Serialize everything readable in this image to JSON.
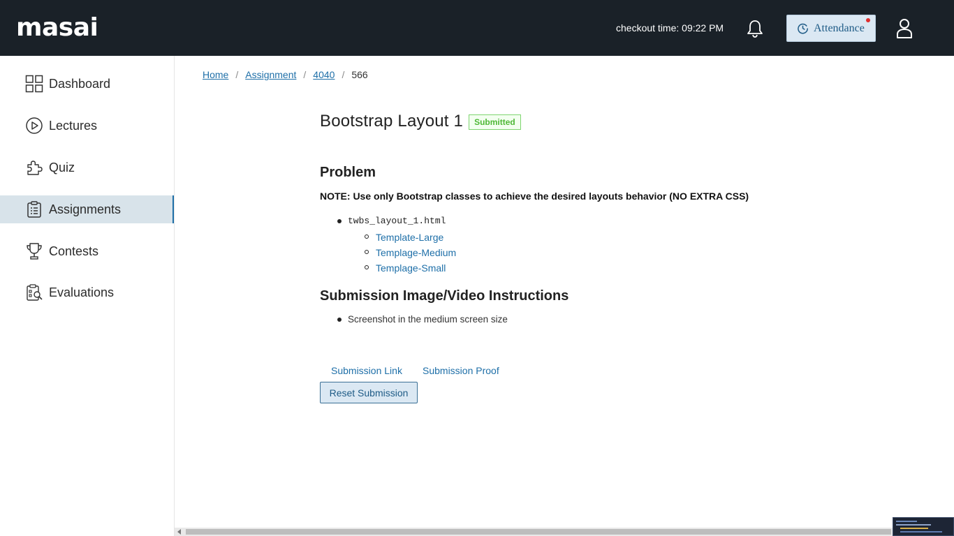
{
  "header": {
    "logo_text": "masai",
    "checkout_time": "checkout time: 09:22 PM",
    "attendance_label": "Attendance"
  },
  "sidebar": {
    "items": [
      {
        "label": "Dashboard",
        "icon": "grid-icon"
      },
      {
        "label": "Lectures",
        "icon": "play-circle-icon"
      },
      {
        "label": "Quiz",
        "icon": "puzzle-icon"
      },
      {
        "label": "Assignments",
        "icon": "clipboard-icon",
        "active": true
      },
      {
        "label": "Contests",
        "icon": "trophy-icon"
      },
      {
        "label": "Evaluations",
        "icon": "evaluation-icon"
      }
    ]
  },
  "breadcrumb": {
    "items": [
      "Home",
      "Assignment",
      "4040"
    ],
    "current": "566"
  },
  "assignment": {
    "title": "Bootstrap Layout 1",
    "status": "Submitted",
    "problem_heading": "Problem",
    "note": "NOTE: Use only Bootstrap classes to achieve the desired layouts behavior (NO EXTRA CSS)",
    "file": "twbs_layout_1.html",
    "templates": [
      "Template-Large",
      "Templage-Medium",
      "Templage-Small"
    ],
    "instructions_heading": "Submission Image/Video Instructions",
    "instructions": [
      "Screenshot in the medium screen size"
    ],
    "submission_link": "Submission Link",
    "submission_proof": "Submission Proof",
    "reset_button": "Reset Submission"
  },
  "colors": {
    "topbar": "#1a2128",
    "accent": "#e02d2d",
    "link": "#1e6fa8",
    "active_nav": "#d8e3ea",
    "badge_green": "#4eb836"
  }
}
